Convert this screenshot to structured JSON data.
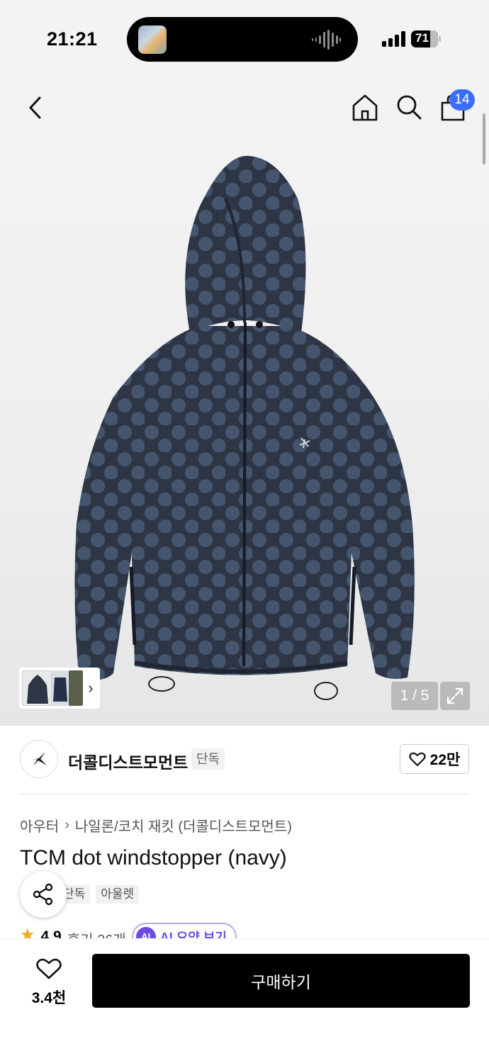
{
  "status_bar": {
    "time": "21:21",
    "battery": "71"
  },
  "header": {
    "cart_count": "14"
  },
  "gallery": {
    "page_indicator": "1 / 5"
  },
  "brand": {
    "name": "더콜디스트모먼트",
    "tag": "단독",
    "likes": "22만"
  },
  "product": {
    "breadcrumb": [
      "아우터",
      "나일론/코치 재킷 (더콜디스트모먼트)"
    ],
    "title": "TCM dot windstopper (navy)",
    "tags": [
      "단독",
      "아울렛"
    ],
    "rating": "4.9",
    "review_label": "후기 26개",
    "ai_summary_label": "AI 요약 보기",
    "ai_badge": "AI"
  },
  "bottom_bar": {
    "wishlist_count": "3.4천",
    "buy_label": "구매하기"
  },
  "colors": {
    "badge_blue": "#3b6ef6",
    "ai_purple": "#6d4de0",
    "star": "#f5a623",
    "jacket_navy": "#2e3645"
  }
}
